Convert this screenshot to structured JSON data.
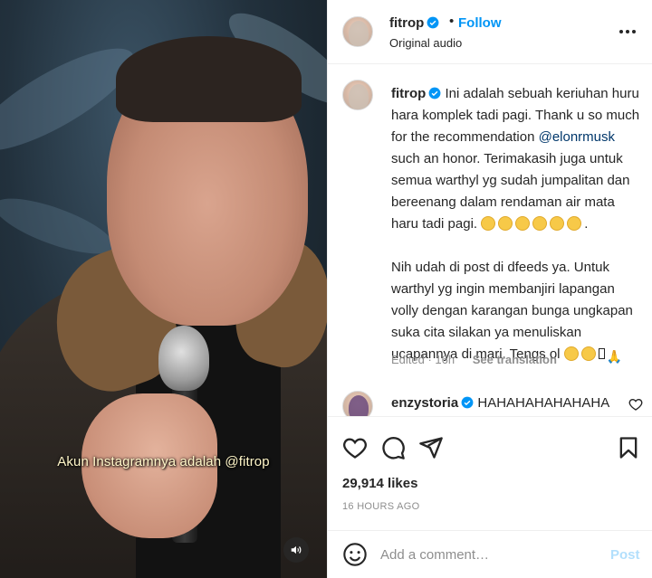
{
  "video": {
    "subtitle": "Akun Instagramnya adalah @fitrop",
    "mute_icon": "speaker-icon"
  },
  "post": {
    "username": "fitrop",
    "follow_label": "Follow",
    "separator": "•",
    "audio": "Original audio",
    "more_icon": "more-horizontal-icon",
    "accent_color": "#0095f6"
  },
  "caption": {
    "username": "fitrop",
    "p1": "Ini adalah sebuah keriuhan huru hara komplek tadi pagi. Thank u so much for the recommendation ",
    "mention": "@elonrmusk",
    "p2": " such an honor. Terimakasih juga untuk semua warthyl yg sudah jumpalitan dan bereenang dalam rendaman air mata haru tadi pagi. ",
    "p3": "Nih udah di post di dfeeds ya. Untuk warthyl yg ingin membanjiri lapangan volly dengan karangan bunga ungkapan suka cita silakan ya menuliskan ucapannya di mari. Tengs ol ",
    "edited": "Edited · 16h",
    "see_translation": "See translation"
  },
  "comment": {
    "username": "enzystoria",
    "text": "HAHAHAHAHAHAHA BENERAN NGGA SIH?"
  },
  "stats": {
    "likes": "29,914 likes",
    "time_ago": "16 HOURS AGO"
  },
  "composer": {
    "placeholder": "Add a comment…",
    "post_label": "Post"
  }
}
